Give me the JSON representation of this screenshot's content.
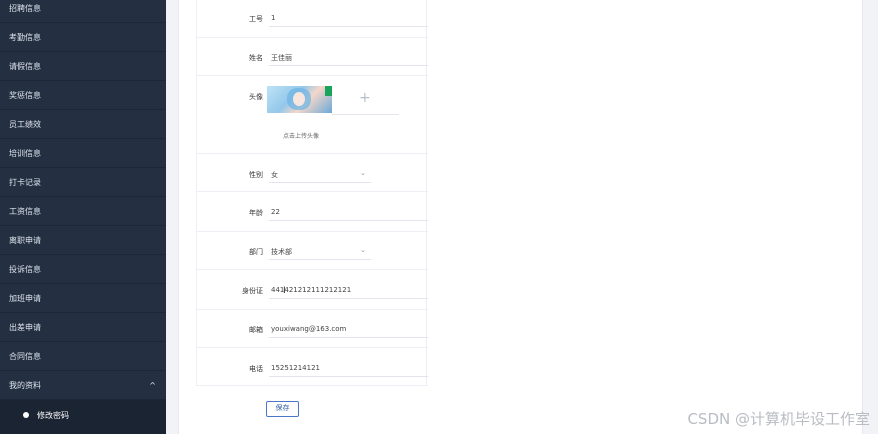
{
  "sidebar": {
    "items": [
      {
        "label": "招聘信息"
      },
      {
        "label": "考勤信息"
      },
      {
        "label": "请假信息"
      },
      {
        "label": "奖惩信息"
      },
      {
        "label": "员工绩效"
      },
      {
        "label": "培训信息"
      },
      {
        "label": "打卡记录"
      },
      {
        "label": "工资信息"
      },
      {
        "label": "离职申请"
      },
      {
        "label": "投诉信息"
      },
      {
        "label": "加班申请"
      },
      {
        "label": "出差申请"
      },
      {
        "label": "合同信息"
      }
    ],
    "profile_label": "我的资料",
    "profile_chevron": "^",
    "sub_item_label": "修改密码"
  },
  "form": {
    "job_no": {
      "label": "工号",
      "value": "1"
    },
    "name": {
      "label": "姓名",
      "value": "王佳丽"
    },
    "avatar": {
      "label": "头像",
      "hint": "点击上传头像",
      "add_icon": "+"
    },
    "gender": {
      "label": "性别",
      "value": "女"
    },
    "age": {
      "label": "年龄",
      "value": "22"
    },
    "department": {
      "label": "部门",
      "value": "技术部"
    },
    "id_card": {
      "label": "身份证",
      "value": "441421212111212121"
    },
    "email": {
      "label": "邮箱",
      "value": "youxiwang@163.com"
    },
    "phone": {
      "label": "电话",
      "value": "15251214121"
    }
  },
  "save_label": "保存",
  "watermark": "CSDN @计算机毕设工作室",
  "colors": {
    "sidebar_bg": "#243042",
    "accent": "#4a76c8"
  }
}
